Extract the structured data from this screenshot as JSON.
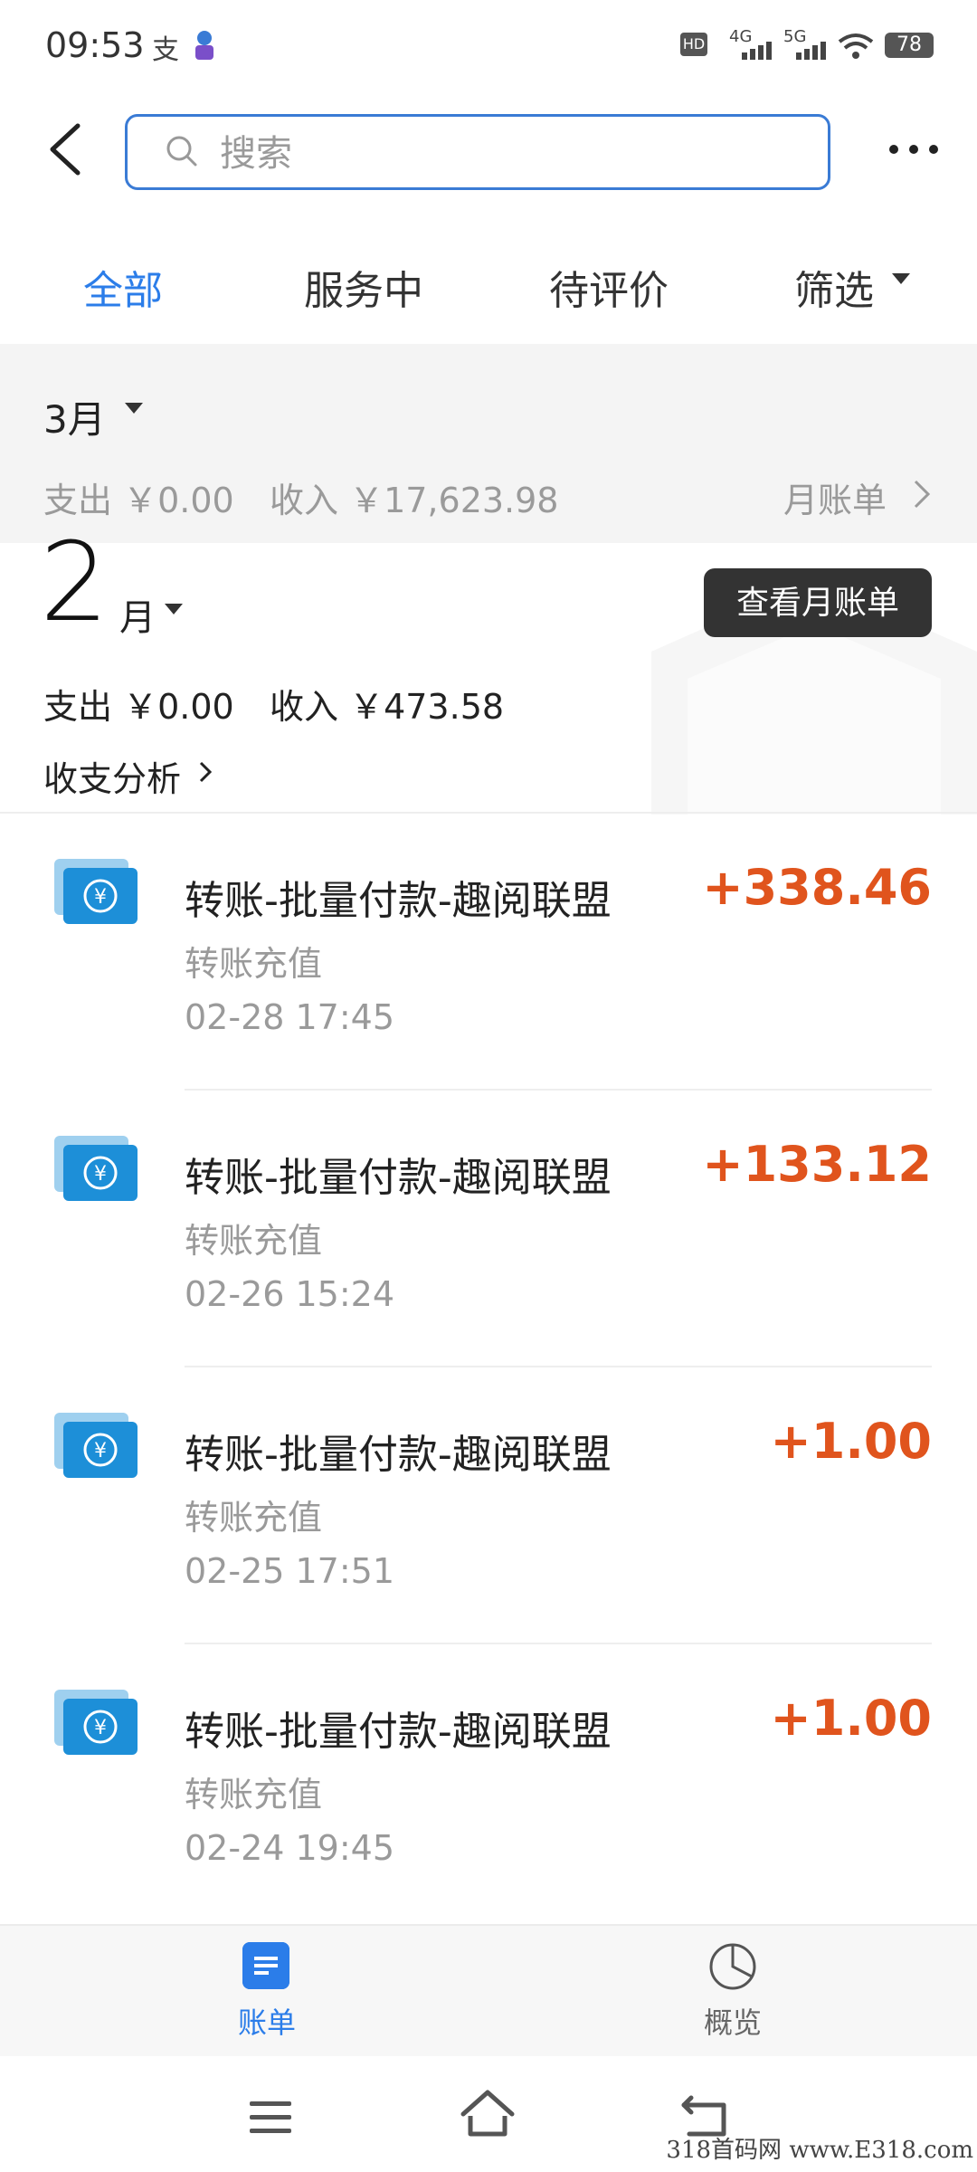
{
  "status_bar": {
    "time": "09:53",
    "carrier_glyph": "支",
    "net1": "4G",
    "net2": "5G",
    "hd": "HD",
    "battery": "78"
  },
  "header": {
    "search_placeholder": "搜索"
  },
  "tabs": [
    {
      "label": "全部",
      "active": true
    },
    {
      "label": "服务中",
      "active": false
    },
    {
      "label": "待评价",
      "active": false
    },
    {
      "label": "筛选",
      "active": false
    }
  ],
  "march": {
    "label": "3月",
    "expense": "支出 ￥0.00",
    "income": "收入 ￥17,623.98",
    "monthly_bill": "月账单"
  },
  "february": {
    "number": "2",
    "unit": "月",
    "view_monthly_button": "查看月账单",
    "expense": "支出 ￥0.00",
    "income": "收入 ￥473.58",
    "analysis": "收支分析"
  },
  "transactions": [
    {
      "title": "转账-批量付款-趣阅联盟",
      "type": "转账充值",
      "date": "02-28  17:45",
      "amount": "+338.46"
    },
    {
      "title": "转账-批量付款-趣阅联盟",
      "type": "转账充值",
      "date": "02-26  15:24",
      "amount": "+133.12"
    },
    {
      "title": "转账-批量付款-趣阅联盟",
      "type": "转账充值",
      "date": "02-25  17:51",
      "amount": "+1.00"
    },
    {
      "title": "转账-批量付款-趣阅联盟",
      "type": "转账充值",
      "date": "02-24  19:45",
      "amount": "+1.00"
    }
  ],
  "bottom_nav": {
    "bill_label": "账单",
    "overview_label": "概览"
  },
  "watermark": "318首码网 www.E318.com",
  "colors": {
    "accent": "#2b7de9",
    "amount": "#e0541d",
    "muted": "#9a9a9a"
  }
}
